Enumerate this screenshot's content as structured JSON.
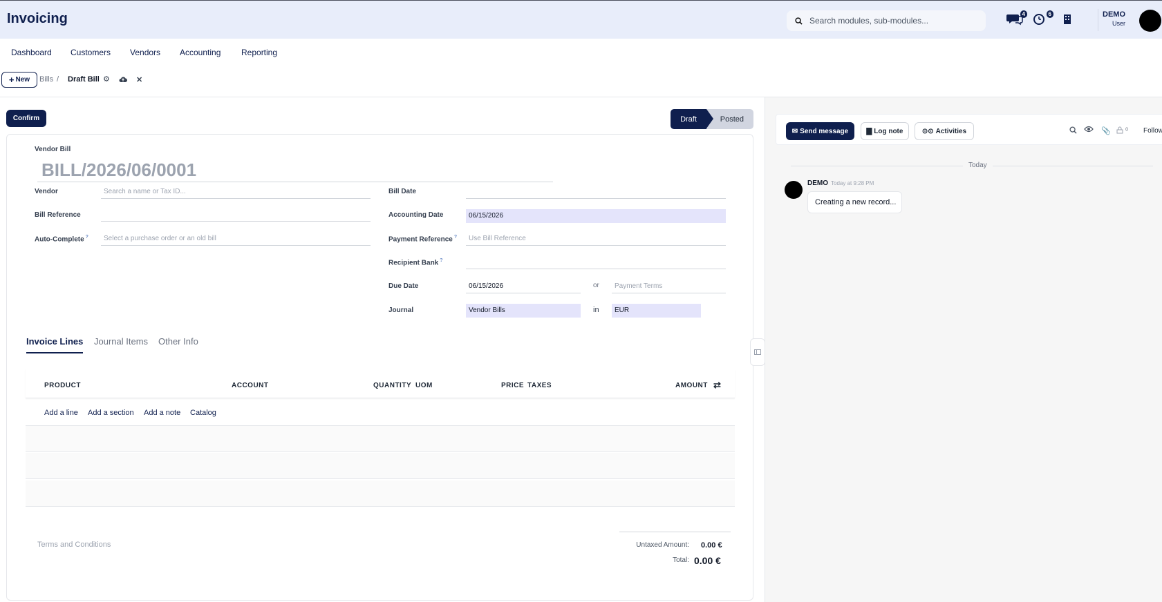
{
  "app": {
    "title": "Invoicing"
  },
  "search": {
    "placeholder": "Search modules, sub-modules..."
  },
  "systray": {
    "messages_badge": "4",
    "activities_badge": "6"
  },
  "user": {
    "name": "DEMO",
    "role": "User"
  },
  "menu": [
    "Dashboard",
    "Customers",
    "Vendors",
    "Accounting",
    "Reporting"
  ],
  "controls": {
    "new_label": "New",
    "breadcrumb_parent": "Bills",
    "breadcrumb_separator": "/",
    "breadcrumb_current": "Draft Bill"
  },
  "form": {
    "confirm_label": "Confirm",
    "status": {
      "draft": "Draft",
      "posted": "Posted"
    },
    "header_label": "Vendor Bill",
    "name": "BILL/2026/06/0001",
    "vendor": {
      "label": "Vendor",
      "placeholder": "Search a name or Tax ID..."
    },
    "bill_reference": {
      "label": "Bill Reference",
      "value": ""
    },
    "auto_complete": {
      "label": "Auto-Complete",
      "help": "?",
      "placeholder": "Select a purchase order or an old bill"
    },
    "bill_date": {
      "label": "Bill Date",
      "value": ""
    },
    "accounting_date": {
      "label": "Accounting Date",
      "value": "06/15/2026"
    },
    "payment_reference": {
      "label": "Payment Reference",
      "help": "?",
      "placeholder": "Use Bill Reference"
    },
    "recipient_bank": {
      "label": "Recipient Bank",
      "help": "?",
      "value": ""
    },
    "due_date": {
      "label": "Due Date",
      "value": "06/15/2026",
      "or": "or",
      "terms_placeholder": "Payment Terms"
    },
    "journal": {
      "label": "Journal",
      "value": "Vendor Bills",
      "in": "in",
      "currency": "EUR"
    },
    "tabs": [
      "Invoice Lines",
      "Journal Items",
      "Other Info"
    ],
    "columns": {
      "product": "PRODUCT",
      "account": "ACCOUNT",
      "quantity": "QUANTITY",
      "uom": "UOM",
      "price": "PRICE",
      "taxes": "TAXES",
      "amount": "AMOUNT"
    },
    "add_links": [
      "Add a line",
      "Add a section",
      "Add a note",
      "Catalog"
    ],
    "terms_placeholder": "Terms and Conditions",
    "totals": {
      "untaxed_label": "Untaxed Amount:",
      "untaxed_value": "0.00 €",
      "total_label": "Total:",
      "total_value": "0.00 €"
    }
  },
  "chatter": {
    "send_message": "Send message",
    "log_note": "Log note",
    "activities": "Activities",
    "followers_count": "0",
    "follow": "Follow",
    "today": "Today",
    "message": {
      "author": "DEMO",
      "time": "Today at 9:28 PM",
      "body": "Creating a new record..."
    }
  },
  "colors": {
    "primary": "#0f1f4e",
    "topbar_bg": "#e8edfa",
    "highlight_field": "#e4e4fb"
  }
}
